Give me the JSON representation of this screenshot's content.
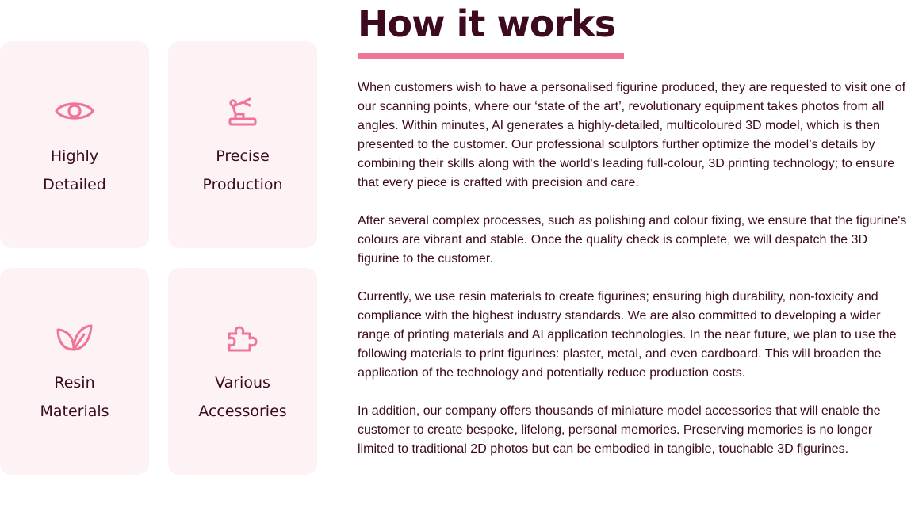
{
  "section": {
    "title": "How it works",
    "accent_color": "#f07496",
    "text_color": "#3d0a20",
    "card_background": "#fdf2f4"
  },
  "features": [
    {
      "icon": "eye-icon",
      "line1": "Highly",
      "line2": "Detailed"
    },
    {
      "icon": "robotic-arm-icon",
      "line1": "Precise",
      "line2": "Production"
    },
    {
      "icon": "leaf-icon",
      "line1": "Resin",
      "line2": "Materials"
    },
    {
      "icon": "puzzle-icon",
      "line1": "Various",
      "line2": "Accessories"
    }
  ],
  "paragraphs": [
    "When customers wish to have a personalised figurine produced, they are requested to visit one of our scanning points, where our ‘state of the art’, revolutionary equipment takes photos from all angles. Within minutes, AI generates a highly-detailed, multicoloured 3D model, which is then presented to the customer. Our professional sculptors further optimize the model’s details by combining their skills along with the world's leading full-colour, 3D printing technology; to ensure that every piece is crafted with precision and care.",
    "After several complex processes, such as polishing and colour fixing, we ensure that the figurine's colours are vibrant and stable. Once the quality check is complete, we will despatch the 3D figurine to the customer.",
    "Currently, we use resin materials to create figurines; ensuring high durability, non-toxicity and compliance with the highest industry standards. We are also committed to developing a wider range of printing materials and AI application technologies. In the near future, we plan to use the following materials to print figurines: plaster, metal, and even cardboard. This will broaden the application of the technology and potentially reduce production costs.",
    "In addition, our company offers thousands of miniature model accessories that will enable the customer to create bespoke, lifelong, personal memories. Preserving memories is no longer limited to traditional 2D photos but can be embodied in tangible, touchable 3D figurines."
  ]
}
